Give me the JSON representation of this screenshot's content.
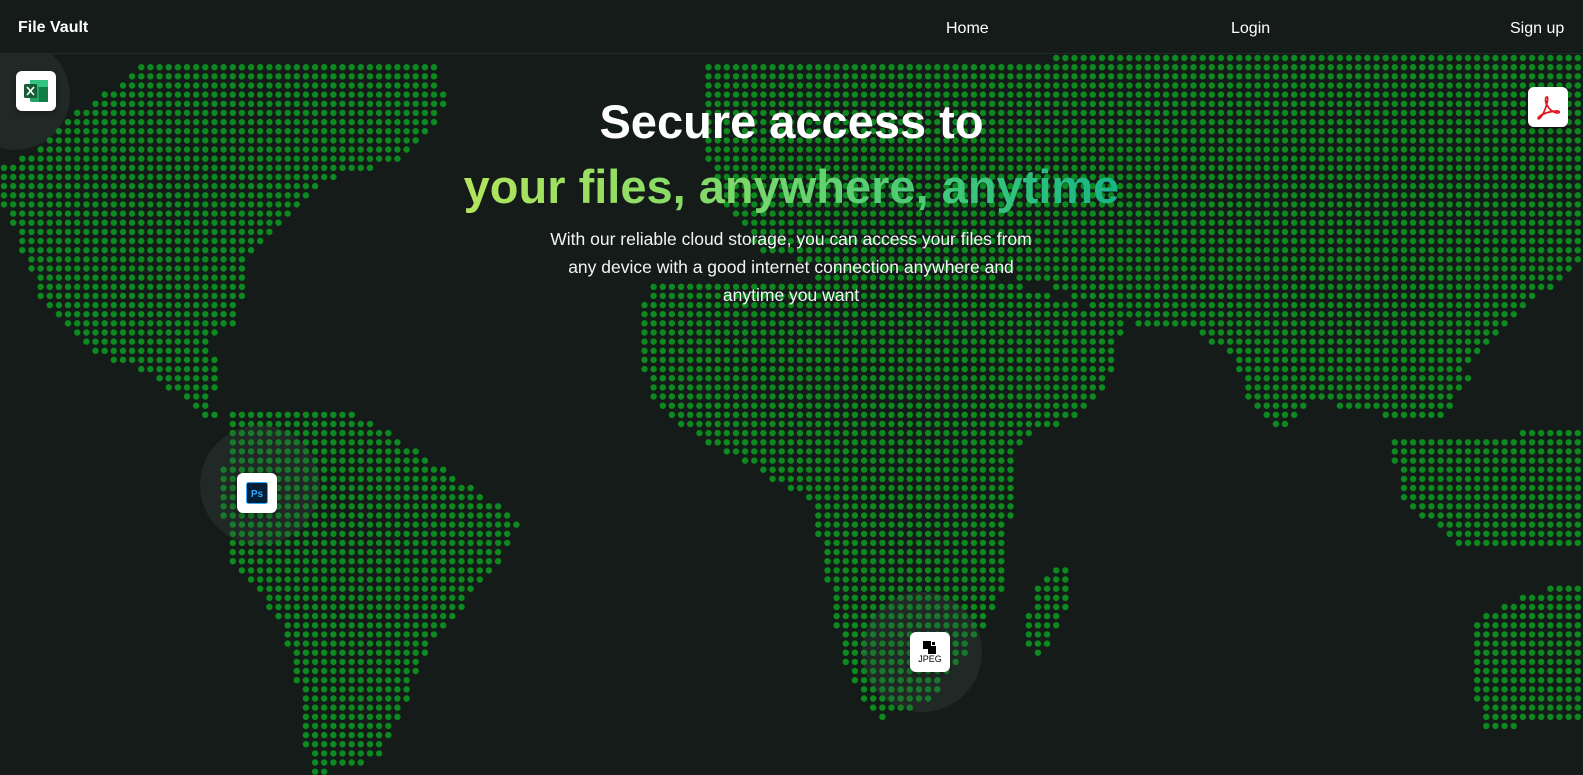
{
  "navbar": {
    "brand": "File Vault",
    "links": [
      "Home",
      "Login",
      "Sign up"
    ]
  },
  "hero": {
    "title_line1": "Secure access to",
    "title_line2": "your files, anywhere, anytime",
    "description": "With our reliable cloud storage, you can access your files from any device with a good internet connection anywhere and anytime you want"
  },
  "floating_icons": {
    "excel": "excel-icon",
    "pdf": "pdf-icon",
    "photoshop": "photoshop-icon",
    "photoshop_label": "Ps",
    "jpeg": "jpeg-icon",
    "jpeg_label": "JPEG"
  },
  "colors": {
    "background": "#151b19",
    "map_dot": "#0c8a1f",
    "gradient_start": "#b2e55c",
    "gradient_end": "#17b587"
  }
}
